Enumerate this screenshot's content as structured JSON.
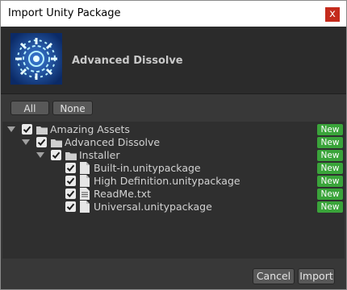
{
  "window": {
    "title": "Import Unity Package",
    "close_glyph": "x"
  },
  "package": {
    "name": "Advanced Dissolve",
    "icon": "dissolve-logo"
  },
  "selection": {
    "all_label": "All",
    "none_label": "None"
  },
  "tree": [
    {
      "label": "Amazing Assets",
      "type": "folder",
      "depth": 0,
      "expanded": true,
      "checked": true,
      "badge": "New"
    },
    {
      "label": "Advanced Dissolve",
      "type": "folder",
      "depth": 1,
      "expanded": true,
      "checked": true,
      "badge": "New"
    },
    {
      "label": "Installer",
      "type": "folder",
      "depth": 2,
      "expanded": true,
      "checked": true,
      "badge": "New"
    },
    {
      "label": "Built-in.unitypackage",
      "type": "file",
      "depth": 3,
      "checked": true,
      "badge": "New"
    },
    {
      "label": "High Definition.unitypackage",
      "type": "file",
      "depth": 3,
      "checked": true,
      "badge": "New"
    },
    {
      "label": "ReadMe.txt",
      "type": "text-file",
      "depth": 3,
      "checked": true,
      "badge": "New"
    },
    {
      "label": "Universal.unitypackage",
      "type": "file",
      "depth": 3,
      "checked": true,
      "badge": "New"
    }
  ],
  "footer": {
    "cancel_label": "Cancel",
    "import_label": "Import"
  },
  "colors": {
    "new_badge": "#3aa43a",
    "close_button": "#c42b1c",
    "panel": "#383838"
  }
}
